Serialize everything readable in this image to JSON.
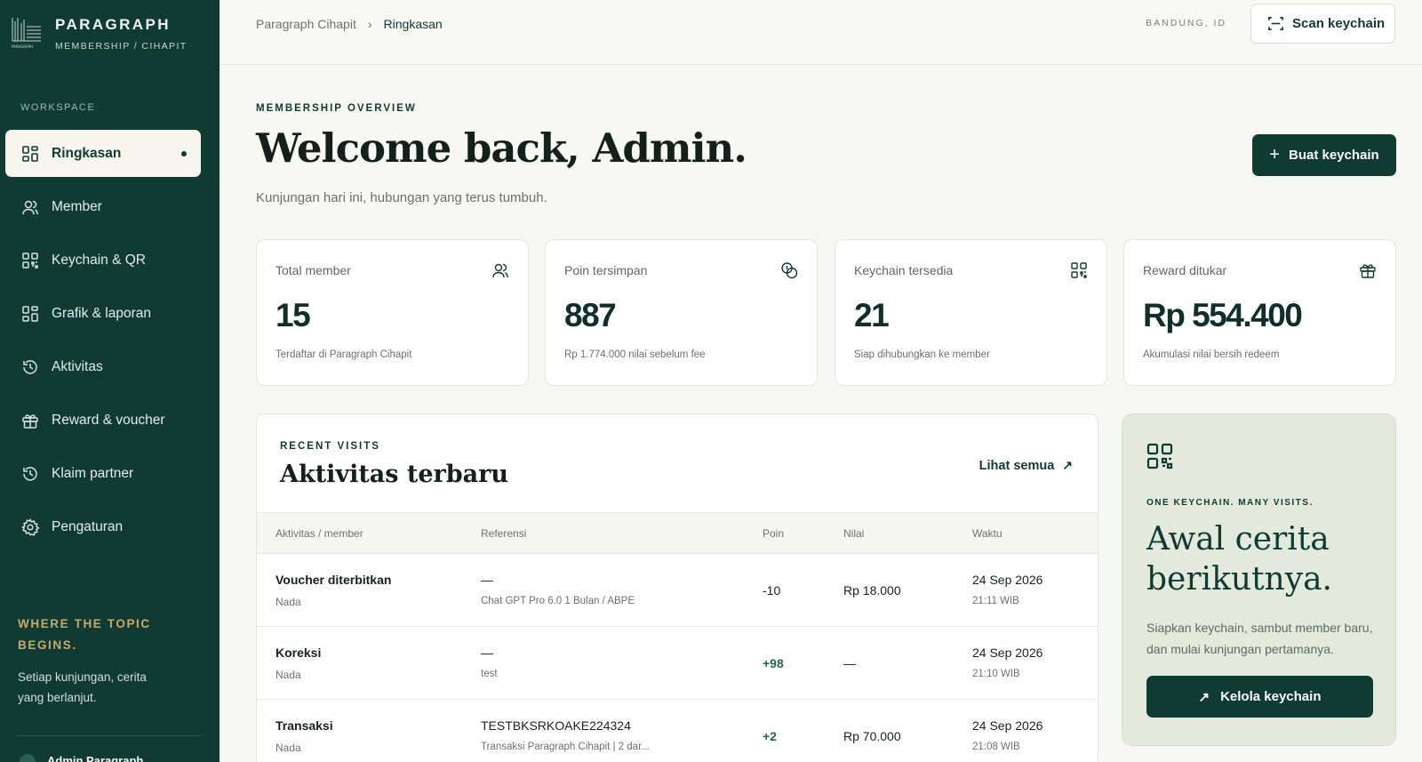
{
  "brand": {
    "name": "PARAGRAPH",
    "subtitle": "MEMBERSHIP / CIHAPIT"
  },
  "sidebar": {
    "section_label": "WORKSPACE",
    "items": [
      {
        "label": "Ringkasan",
        "icon": "grid-icon",
        "active": true
      },
      {
        "label": "Member",
        "icon": "users-icon"
      },
      {
        "label": "Keychain & QR",
        "icon": "qr-icon"
      },
      {
        "label": "Grafik & laporan",
        "icon": "grid-icon"
      },
      {
        "label": "Aktivitas",
        "icon": "history-icon"
      },
      {
        "label": "Reward & voucher",
        "icon": "gift-icon"
      },
      {
        "label": "Klaim partner",
        "icon": "history-icon"
      },
      {
        "label": "Pengaturan",
        "icon": "gear-icon"
      }
    ],
    "tagline": "WHERE THE TOPIC BEGINS.",
    "tagline_sub": "Setiap kunjungan, cerita yang berlanjut.",
    "user_name": "Admin Paragraph"
  },
  "topbar": {
    "breadcrumb_root": "Paragraph Cihapit",
    "breadcrumb_sep": "›",
    "breadcrumb_current": "Ringkasan",
    "location": "BANDUNG, ID",
    "scan_label": "Scan keychain"
  },
  "header": {
    "eyebrow": "MEMBERSHIP OVERVIEW",
    "title": "Welcome back, Admin.",
    "subtitle": "Kunjungan hari ini, hubungan yang terus tumbuh.",
    "create_label": "Buat keychain",
    "create_plus": "+"
  },
  "stats": [
    {
      "label": "Total member",
      "value": "15",
      "note": "Terdaftar di Paragraph Cihapit",
      "icon": "users-icon"
    },
    {
      "label": "Poin tersimpan",
      "value": "887",
      "note": "Rp 1.774.000 nilai sebelum fee",
      "icon": "coins-icon"
    },
    {
      "label": "Keychain tersedia",
      "value": "21",
      "note": "Siap dihubungkan ke member",
      "icon": "qr-icon"
    },
    {
      "label": "Reward ditukar",
      "value": "Rp 554.400",
      "note": "Akumulasi nilai bersih redeem",
      "icon": "gift-icon"
    }
  ],
  "activity": {
    "eyebrow": "RECENT VISITS",
    "title": "Aktivitas terbaru",
    "see_all": "Lihat semua",
    "see_all_arrow": "↗",
    "columns": [
      "Aktivitas / member",
      "Referensi",
      "Poin",
      "Nilai",
      "Waktu"
    ],
    "rows": [
      {
        "activity": "Voucher diterbitkan",
        "member": "Nada",
        "ref": "—",
        "ref_sub": "Chat GPT Pro 6.0 1 Bulan / ABPE",
        "points": "-10",
        "value": "Rp 18.000",
        "date": "24 Sep 2026",
        "time": "21:11 WIB"
      },
      {
        "activity": "Koreksi",
        "member": "Nada",
        "ref": "—",
        "ref_sub": "test",
        "points": "+98",
        "value": "—",
        "date": "24 Sep 2026",
        "time": "21:10 WIB"
      },
      {
        "activity": "Transaksi",
        "member": "Nada",
        "ref": "TESTBKSRKOAKE224324",
        "ref_sub": "Transaksi Paragraph Cihapit | 2 dar...",
        "points": "+2",
        "value": "Rp 70.000",
        "date": "24 Sep 2026",
        "time": "21:08 WIB"
      }
    ]
  },
  "promo": {
    "eyebrow": "ONE KEYCHAIN. MANY VISITS.",
    "title": "Awal cerita berikutnya.",
    "subtitle": "Siapkan keychain, sambut member baru, dan mulai kunjungan pertamanya.",
    "button": "Kelola keychain",
    "button_arrow": "↗"
  },
  "colors": {
    "brand": "#0f3b33",
    "accent_gold": "#c9a86a",
    "promo_bg": "#e3eadc",
    "positive": "#1f6b4a"
  }
}
